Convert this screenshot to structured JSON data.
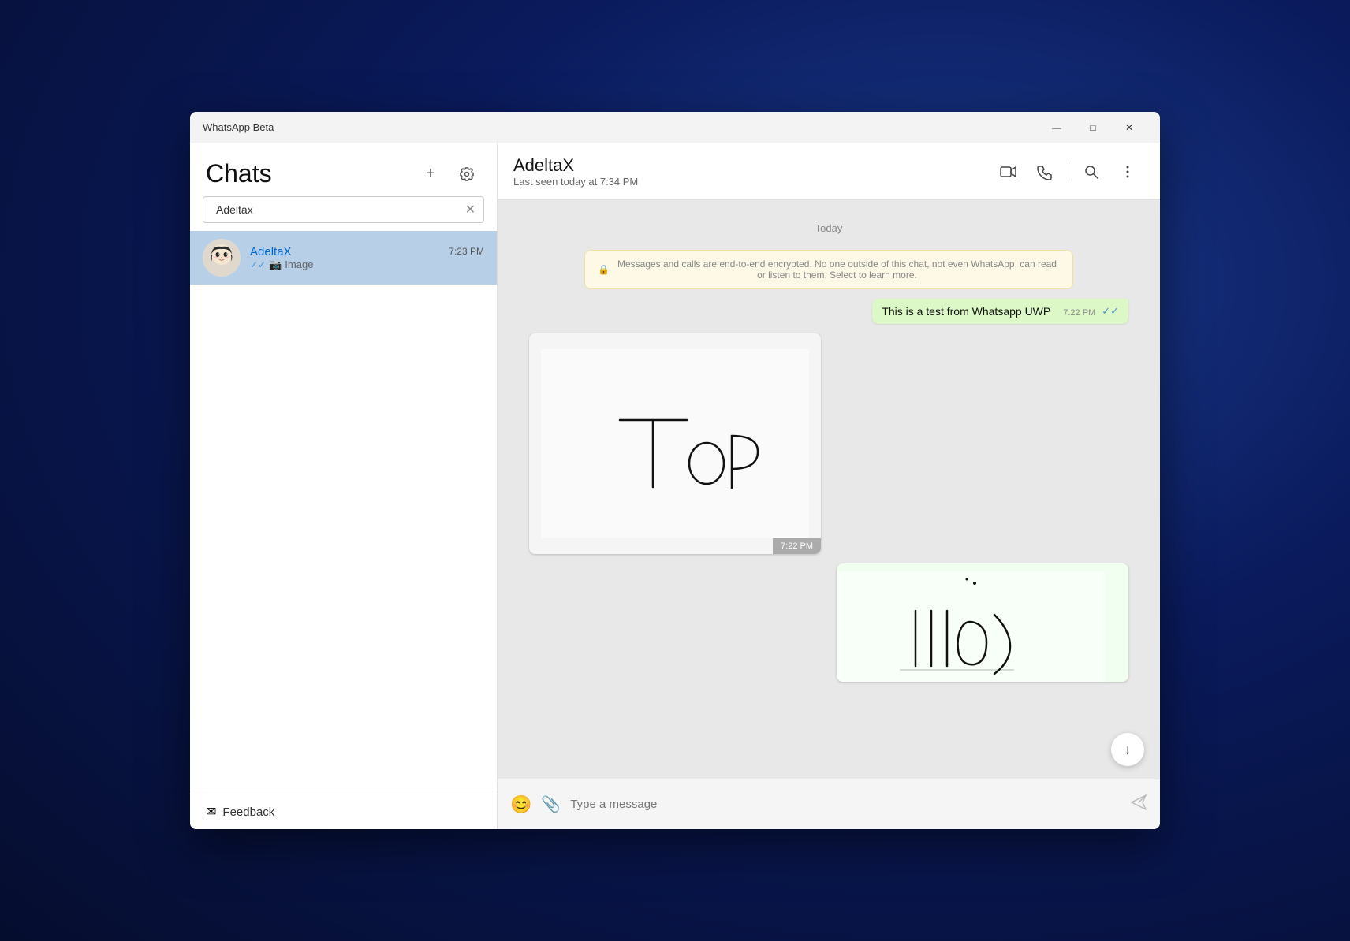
{
  "window": {
    "title": "WhatsApp Beta",
    "minimize": "—",
    "maximize": "□",
    "close": "✕"
  },
  "sidebar": {
    "title": "Chats",
    "search_placeholder": "Adeltax",
    "add_icon": "+",
    "settings_icon": "⚙",
    "feedback_label": "Feedback",
    "chats": [
      {
        "name": "AdeltaX",
        "time": "7:23 PM",
        "preview": "Image",
        "active": true
      }
    ]
  },
  "chat": {
    "name": "AdeltaX",
    "status": "Last seen today at 7:34 PM",
    "date_divider": "Today",
    "encryption_notice": "Messages and calls are end-to-end encrypted. No one outside of this chat, not even WhatsApp, can read or listen to them. Select to learn more.",
    "messages": [
      {
        "text": "This is a test from Whatsapp UWP",
        "time": "7:22 PM",
        "direction": "out"
      },
      {
        "type": "image",
        "time": "7:22 PM",
        "direction": "in"
      },
      {
        "type": "image",
        "direction": "out"
      }
    ],
    "message_input_placeholder": "Type a message"
  },
  "icons": {
    "video_call": "📹",
    "phone_call": "📞",
    "search": "🔍",
    "more": "⋯",
    "emoji": "😊",
    "attach": "📎",
    "send": "➤",
    "lock": "🔒",
    "feedback": "✉",
    "down_arrow": "↓"
  }
}
